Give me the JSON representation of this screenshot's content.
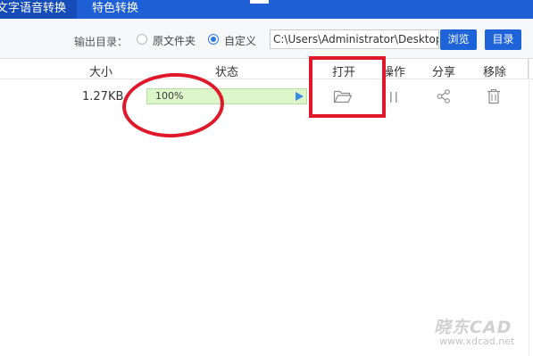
{
  "tabs": [
    {
      "label": "文字语音转换"
    },
    {
      "label": "特色转换"
    }
  ],
  "output_bar": {
    "label": "输出目录：",
    "options": [
      "原文件夹",
      "自定义"
    ],
    "selected": "自定义",
    "path_value": "C:\\Users\\Administrator\\Desktop",
    "browse_label": "浏览",
    "dir_label": "目录"
  },
  "columns": {
    "size": "大小",
    "status": "状态",
    "open": "打开",
    "operation": "操作",
    "share": "分享",
    "remove": "移除"
  },
  "file_row": {
    "size": "1.27KB",
    "progress": 100,
    "progress_text": "100%"
  },
  "icons": [
    "play-icon",
    "folder-icon",
    "pause-icon",
    "share-icon",
    "trash-icon"
  ],
  "colors": {
    "accent": "#1e5fd6",
    "progress_bg": "#dcf5c9",
    "annotation": "#e0192a"
  },
  "watermark": {
    "logo": "晓东CAD",
    "url": "www.xdcad.net"
  }
}
